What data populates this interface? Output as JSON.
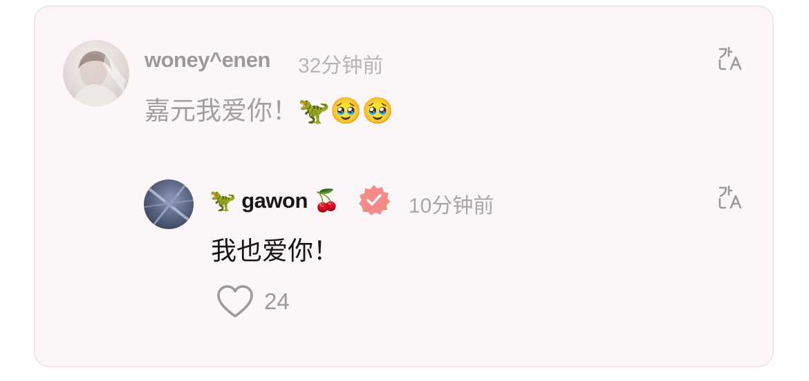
{
  "comment": {
    "username": "woney^enen",
    "timestamp": "32分钟前",
    "text": "嘉元我爱你！🦖🥹🥹",
    "avatar_icon": "avatar-photo-icon",
    "translate_icon": "translate-icon"
  },
  "reply": {
    "username_prefix": "🦖",
    "username": "gawon",
    "username_suffix": "🍒",
    "verified_color": "#f38b88",
    "timestamp": "10分钟前",
    "text": "我也爱你！",
    "avatar_icon": "avatar-photo-icon",
    "translate_icon": "translate-icon",
    "likes": {
      "icon": "heart-icon",
      "count": "24"
    }
  },
  "colors": {
    "card_background": "#fcf6f9",
    "card_border": "#f6e3ea",
    "verified_badge": "#f38b88"
  }
}
